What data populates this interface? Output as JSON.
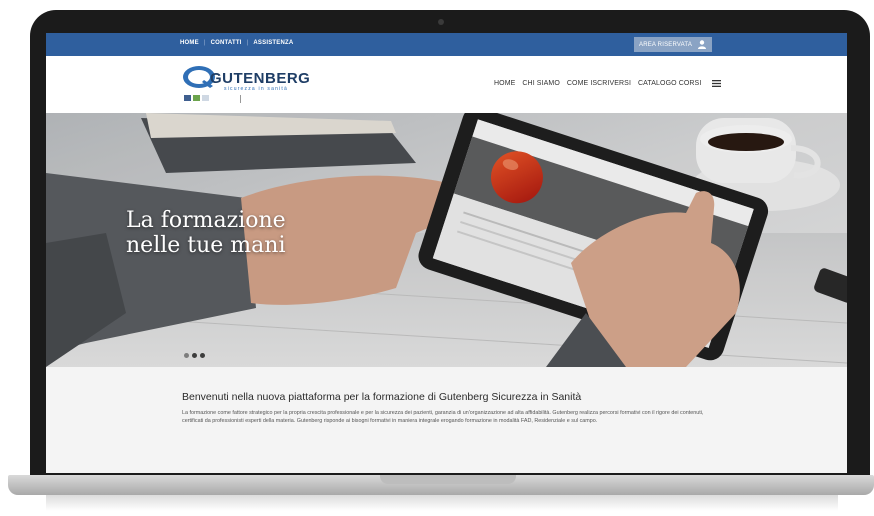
{
  "topbar": {
    "links": [
      "HOME",
      "CONTATTI",
      "ASSISTENZA"
    ],
    "reserved_label": "AREA RISERVATA",
    "color": "#2f5f9e"
  },
  "logo": {
    "name": "GUTENBERG",
    "tagline": "sicurezza in sanità"
  },
  "mainnav": {
    "items": [
      "HOME",
      "CHI SIAMO",
      "COME ISCRIVERSI",
      "CATALOGO CORSI"
    ]
  },
  "hero": {
    "title_line1": "La formazione",
    "title_line2": "nelle tue mani",
    "slides_count": 3,
    "active_slide": 3
  },
  "content": {
    "welcome": "Benvenuti nella nuova piattaforma per la formazione di Gutenberg Sicurezza in Sanità",
    "intro": "La formazione come fattore strategico per la propria crescita professionale e per la sicurezza dei pazienti, garanzia di un'organizzazione ad alta affidabilità. Gutenberg realizza percorsi formativi con il rigore dei contenuti, certificati da professionisti esperti della materia. Gutenberg risponde ai bisogni formativi in maniera integrale erogando formazione in modalità FAD, Residenziale e sul campo."
  },
  "icons": {
    "user": "user-icon",
    "menu": "hamburger-menu-icon"
  }
}
